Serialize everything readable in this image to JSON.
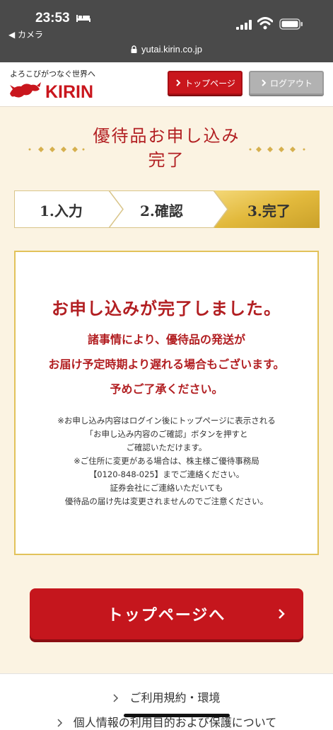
{
  "status_bar": {
    "time": "23:53",
    "back_label": "◀ カメラ",
    "url": "yutai.kirin.co.jp",
    "icons": [
      "bed-icon",
      "signal-icon",
      "wifi-icon",
      "battery-icon",
      "lock-icon"
    ]
  },
  "header": {
    "tagline": "よろこびがつなぐ世界へ",
    "logo_text": "KIRIN",
    "top_page_button": "トップページ",
    "logout_button": "ログアウト"
  },
  "page": {
    "title_line1": "優待品お申し込み",
    "title_line2": "完了"
  },
  "steps": [
    {
      "label": "1.入力",
      "active": false
    },
    {
      "label": "2.確認",
      "active": false
    },
    {
      "label": "3.完了",
      "active": true
    }
  ],
  "message": {
    "headline": "お申し込みが完了しました。",
    "sub_line1": "諸事情により、優待品の発送が",
    "sub_line2": "お届け予定時期より遅れる場合もございます。",
    "sub_line3": "予めご了承ください。",
    "notes": [
      "※お申し込み内容はログイン後にトップページに表示される",
      "「お申し込み内容のご確認」ボタンを押すと",
      "ご確認いただけます。",
      "※ご住所に変更がある場合は、株主様ご優待事務局",
      "【0120-848-025】までご連絡ください。",
      "証券会社にご連絡いただいても",
      "優待品の届け先は変更されませんのでご注意ください。"
    ]
  },
  "cta": {
    "label": "トップページへ"
  },
  "footer": {
    "links": [
      "ご利用規約・環境",
      "個人情報の利用目的および保護について"
    ]
  },
  "colors": {
    "brand_red": "#c5161d",
    "beige_bg": "#fbf3e2",
    "gold": "#e2c25a",
    "status_bar": "#4a4a4a"
  }
}
